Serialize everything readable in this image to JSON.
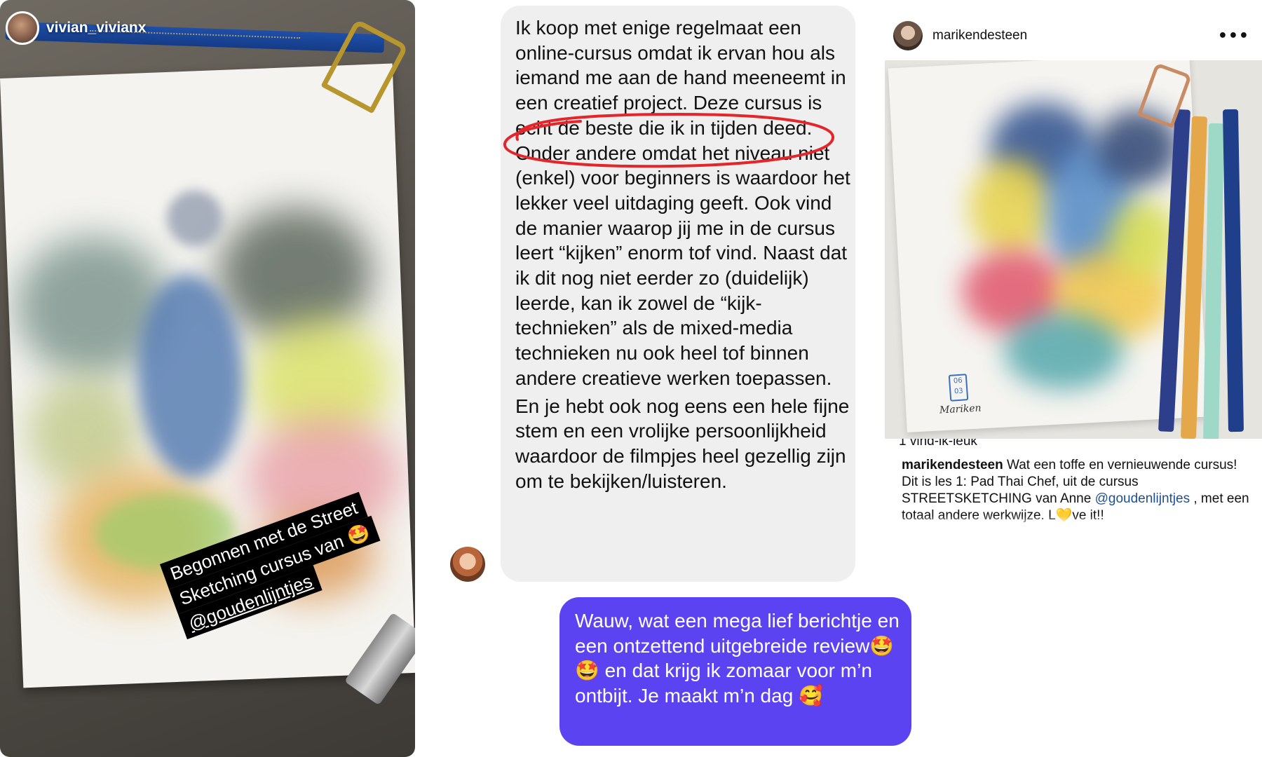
{
  "story": {
    "username": "vivian_vivianx",
    "sticker": {
      "line1": "Begonnen met de Street",
      "line2": "Sketching cursus van 🤩",
      "line3": "@goudenlijntjes"
    }
  },
  "chat": {
    "received": {
      "paragraph1": "Ik koop met enige regelmaat een online-cursus omdat ik ervan hou als iemand me aan de hand meeneemt in een creatief project. Deze cursus is echt de beste die ik in tijden deed. Onder andere omdat het niveau niet (enkel) voor beginners is waardoor het lekker veel uitdaging geeft. Ook vind de manier waarop jij me in de cursus leert “kijken” enorm tof vind. Naast dat ik dit nog niet eerder zo (duidelijk) leerde, kan ik zowel de “kijk-technieken” als de mixed-media technieken nu ook heel tof binnen andere creatieve werken toepassen.",
      "paragraph2": "En je hebt ook nog eens een hele fijne stem en een vrolijke persoonlijkheid waardoor de filmpjes heel gezellig zijn om te bekijken/luisteren."
    },
    "sent": {
      "text": "Wauw, wat een mega lief berichtje en een ontzettend uitgebreide review🤩 🤩  en dat krijg ik zomaar voor m’n ontbijt. Je maakt m’n dag 🥰"
    },
    "highlight_color": "#e3262b"
  },
  "post": {
    "username": "marikendesteen",
    "more": "•••",
    "meta_cut": "1 vind-ik-leuk",
    "image_date": "06 03",
    "image_signature": "Mariken",
    "caption": {
      "user": "marikendesteen",
      "text_before": " Wat een toffe en vernieuwende cursus! Dit is les 1: Pad Thai Chef, uit de cursus STREETSKETCHING van Anne ",
      "mention": "@goudenlijntjes",
      "text_after": " , met een totaal andere werkwijze. L💛ve it!!"
    }
  },
  "colors": {
    "sent_bubble": "#5b43f2",
    "received_bubble": "#efefef",
    "mention_link": "#1f4f8f"
  }
}
